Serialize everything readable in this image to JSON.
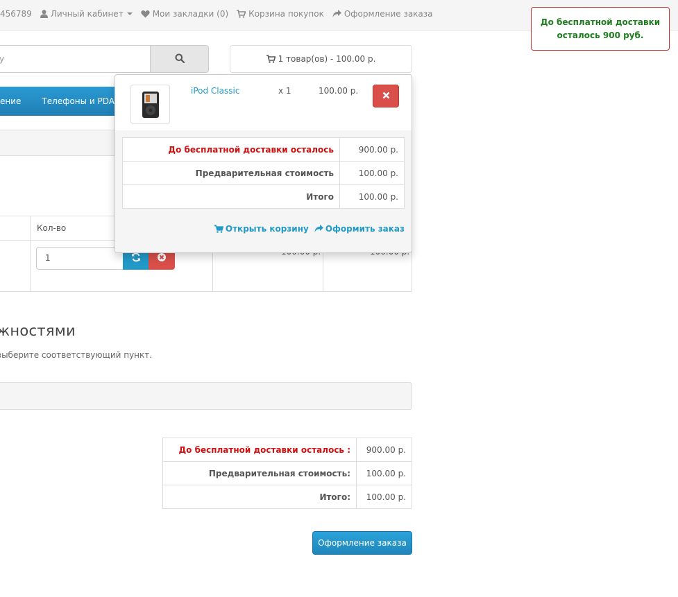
{
  "topbar": {
    "phone": "456789",
    "account": "Личный кабинет",
    "wishlist": "Мои закладки (0)",
    "cart": "Корзина покупок",
    "checkout": "Оформление заказа"
  },
  "free_delivery_banner": "До бесплатной доставки осталось 900 руб.",
  "search": {
    "placeholder": "у"
  },
  "cart_button": "1 товар(ов) - 100.00 р.",
  "menu": {
    "items": [
      "ение",
      "Телефоны и PDA"
    ]
  },
  "cart_table": {
    "qty_header": "Кол-во",
    "qty_value": "1",
    "unit_price": "100.00 р.",
    "total_price": "100.00 р."
  },
  "dropdown": {
    "product_name": "iPod Classic",
    "product_qty": "x 1",
    "product_price": "100.00 р.",
    "totals": [
      {
        "label": "До бесплатной доставки осталось",
        "value": "900.00 р."
      },
      {
        "label": "Предварительная стоимость",
        "value": "100.00 р."
      },
      {
        "label": "Итого",
        "value": "100.00 р."
      }
    ],
    "view_cart": "Открыть корзину",
    "checkout": "Оформить заказ"
  },
  "section": {
    "title": "ожностями",
    "subtitle": "выберите соответствующий пункт."
  },
  "totals": [
    {
      "label": "До бесплатной доставки осталось :",
      "value": "900.00 р."
    },
    {
      "label": "Предварительная стоимость:",
      "value": "100.00 р."
    },
    {
      "label": "Итого:",
      "value": "100.00 р."
    }
  ],
  "checkout_button": "Оформление заказа",
  "colors": {
    "accent": "#229ac8",
    "danger": "#da4f49",
    "free_delivery_text": "#1e7d1e",
    "free_delivery_label": "#d01010"
  }
}
